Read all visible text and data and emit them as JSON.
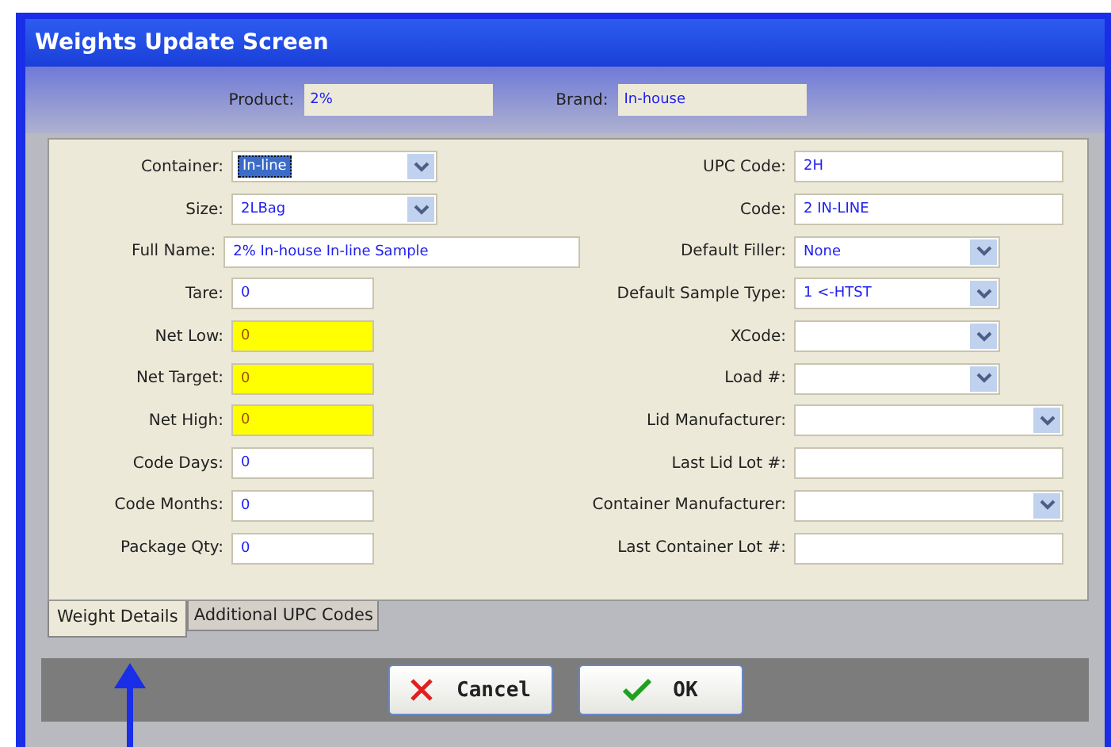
{
  "window": {
    "title": "Weights Update Screen"
  },
  "header": [
    {
      "label": "Product:",
      "value": "2%"
    },
    {
      "label": "Brand:",
      "value": "In-house"
    }
  ],
  "left_fields": [
    {
      "label": "Container:",
      "value": "In-line",
      "kind": "select",
      "focused": true,
      "highlighted": false
    },
    {
      "label": "Size:",
      "value": "2LBag",
      "kind": "select",
      "focused": false,
      "highlighted": false
    },
    {
      "label": "Full Name:",
      "value": "2% In-house In-line Sample",
      "kind": "text",
      "focused": false,
      "highlighted": false
    },
    {
      "label": "Tare:",
      "value": "0",
      "kind": "text",
      "focused": false,
      "highlighted": false
    },
    {
      "label": "Net Low:",
      "value": "0",
      "kind": "text",
      "focused": false,
      "highlighted": true
    },
    {
      "label": "Net Target:",
      "value": "0",
      "kind": "text",
      "focused": false,
      "highlighted": true
    },
    {
      "label": "Net High:",
      "value": "0",
      "kind": "text",
      "focused": false,
      "highlighted": true
    },
    {
      "label": "Code Days:",
      "value": "0",
      "kind": "text",
      "focused": false,
      "highlighted": false
    },
    {
      "label": "Code Months:",
      "value": "0",
      "kind": "text",
      "focused": false,
      "highlighted": false
    },
    {
      "label": "Package Qty:",
      "value": "0",
      "kind": "text",
      "focused": false,
      "highlighted": false
    }
  ],
  "right_fields": [
    {
      "label": "UPC Code:",
      "value": "2H",
      "kind": "text"
    },
    {
      "label": "Code:",
      "value": "2 IN-LINE",
      "kind": "text"
    },
    {
      "label": "Default Filler:",
      "value": "None",
      "kind": "select"
    },
    {
      "label": "Default Sample Type:",
      "value": "1 <-HTST",
      "kind": "select"
    },
    {
      "label": "XCode:",
      "kind": "select"
    },
    {
      "label": "Load #:",
      "kind": "select"
    },
    {
      "label": "Lid Manufacturer:",
      "kind": "select"
    },
    {
      "label": "Last Lid Lot #:",
      "kind": "text"
    },
    {
      "label": "Container Manufacturer:",
      "kind": "select"
    },
    {
      "label": "Last Container Lot #:",
      "kind": "text"
    }
  ],
  "tabs": [
    {
      "label": "Weight Details",
      "selected": true
    },
    {
      "label": "Additional UPC Codes",
      "selected": false
    }
  ],
  "buttons": [
    {
      "label": "Cancel",
      "kind": "cancel"
    },
    {
      "label": "OK",
      "kind": "ok"
    }
  ]
}
